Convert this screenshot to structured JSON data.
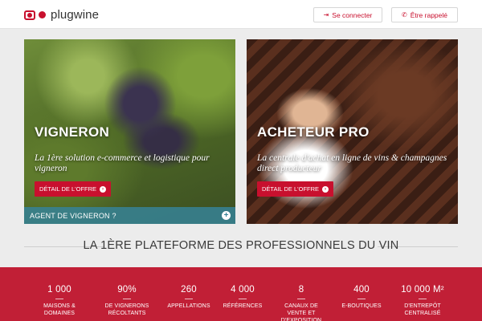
{
  "header": {
    "logo_text": "plugwine",
    "login_label": "Se connecter",
    "call_label": "Être rappelé",
    "brand_color": "#c8102e"
  },
  "cards": [
    {
      "title": "VIGNERON",
      "tagline": "La 1ère solution e-commerce et logistique pour vigneron",
      "offer_label": "DÉTAIL DE L'OFFRE",
      "agent_label": "AGENT DE VIGNERON ?"
    },
    {
      "title": "ACHETEUR PRO",
      "tagline": "La centrale d'achat en ligne de vins & champagnes direct producteur",
      "offer_label": "DÉTAIL DE L'OFFRE"
    }
  ],
  "headline": "LA 1ÈRE PLATEFORME DES PROFESSIONNELS DU VIN",
  "stats": [
    {
      "value": "1 000",
      "label": "MAISONS & DOMAINES"
    },
    {
      "value": "90%",
      "label": "DE VIGNERONS RÉCOLTANTS"
    },
    {
      "value": "260",
      "label": "APPELLATIONS"
    },
    {
      "value": "4 000",
      "label": "RÉFÉRENCES"
    },
    {
      "value": "8",
      "label": "CANAUX DE VENTE ET D'EXPOSITION"
    },
    {
      "value": "400",
      "label": "E-BOUTIQUES"
    },
    {
      "value": "10 000 M²",
      "label": "D'ENTREPÔT CENTRALISÉ"
    }
  ],
  "stats_color": "#c11f36"
}
